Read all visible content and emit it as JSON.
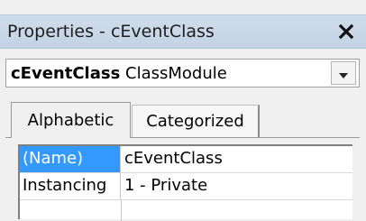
{
  "window": {
    "title": "Properties - cEventClass",
    "close_icon": "close-icon"
  },
  "object_selector": {
    "object_name": "cEventClass",
    "object_type": "ClassModule",
    "dropdown_icon": "chevron-down-icon"
  },
  "tabs": [
    {
      "label": "Alphabetic",
      "active": true
    },
    {
      "label": "Categorized",
      "active": false
    }
  ],
  "properties": [
    {
      "name": "(Name)",
      "value": "cEventClass",
      "selected": true
    },
    {
      "name": "Instancing",
      "value": "1 - Private",
      "selected": false
    }
  ],
  "colors": {
    "selection": "#3399ff",
    "titlebar": "#c9d8e8"
  }
}
